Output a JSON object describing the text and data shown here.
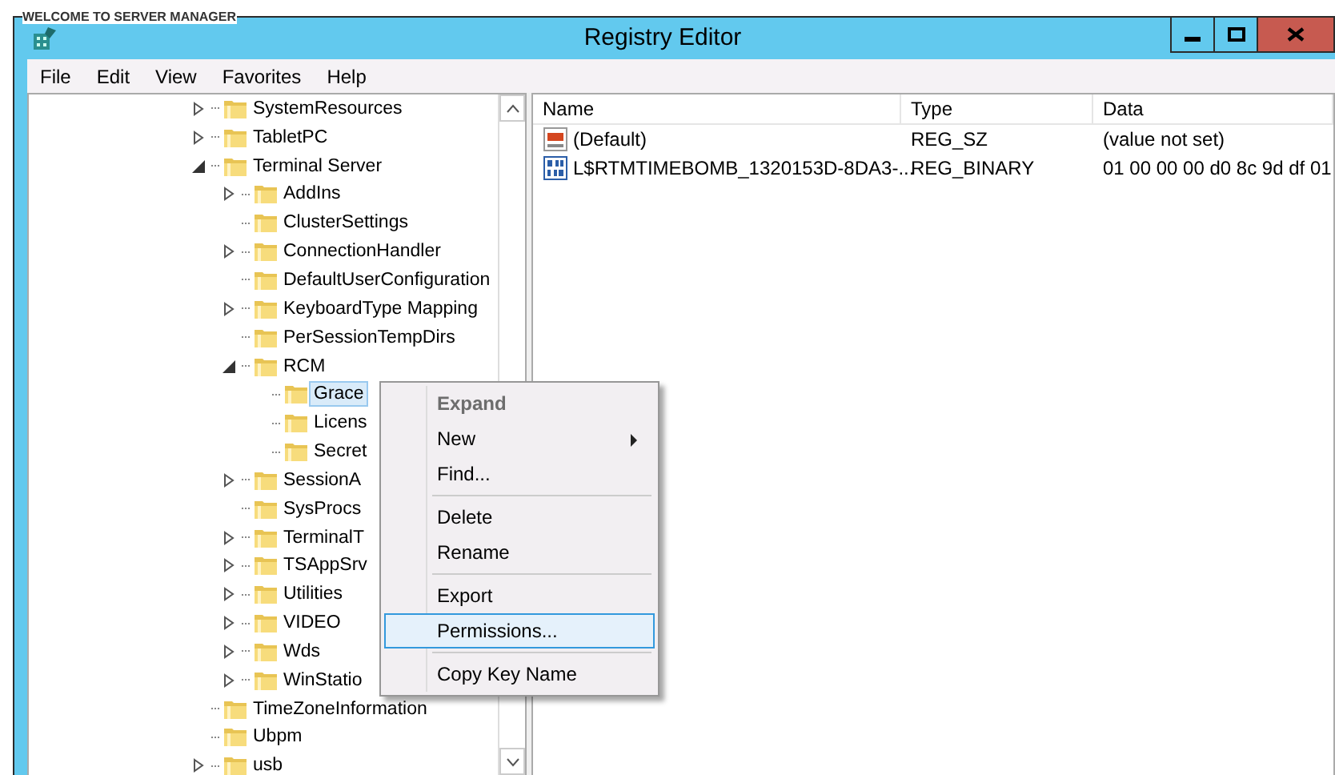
{
  "background": {
    "title": "WELCOME TO SERVER MANAGER"
  },
  "window": {
    "title": "Registry Editor"
  },
  "menu_bar": [
    "File",
    "Edit",
    "View",
    "Favorites",
    "Help"
  ],
  "tree": [
    {
      "label": "SystemResources",
      "kind": "branch",
      "expanded": false,
      "selected": false
    },
    {
      "label": "TabletPC",
      "kind": "branch",
      "expanded": false,
      "selected": false
    },
    {
      "label": "Terminal Server",
      "kind": "branch",
      "expanded": true,
      "selected": false,
      "children": [
        {
          "label": "AddIns",
          "kind": "branch",
          "expanded": false,
          "selected": false
        },
        {
          "label": "ClusterSettings",
          "kind": "leaf",
          "selected": false
        },
        {
          "label": "ConnectionHandler",
          "kind": "branch",
          "expanded": false,
          "selected": false
        },
        {
          "label": "DefaultUserConfiguration",
          "kind": "leaf",
          "selected": false
        },
        {
          "label": "KeyboardType Mapping",
          "kind": "branch",
          "expanded": false,
          "selected": false
        },
        {
          "label": "PerSessionTempDirs",
          "kind": "leaf",
          "selected": false
        },
        {
          "label": "RCM",
          "kind": "branch",
          "expanded": true,
          "selected": false,
          "children": [
            {
              "label": "Grace",
              "kind": "leaf",
              "selected": true
            },
            {
              "label": "Licens",
              "kind": "leaf",
              "selected": false
            },
            {
              "label": "Secret",
              "kind": "leaf",
              "selected": false
            }
          ]
        },
        {
          "label": "SessionA",
          "kind": "branch",
          "expanded": false,
          "selected": false
        },
        {
          "label": "SysProcs",
          "kind": "leaf",
          "selected": false
        },
        {
          "label": "TerminalT",
          "kind": "branch",
          "expanded": false,
          "selected": false
        },
        {
          "label": "TSAppSrv",
          "kind": "branch",
          "expanded": false,
          "selected": false
        },
        {
          "label": "Utilities",
          "kind": "branch",
          "expanded": false,
          "selected": false
        },
        {
          "label": "VIDEO",
          "kind": "branch",
          "expanded": false,
          "selected": false
        },
        {
          "label": "Wds",
          "kind": "branch",
          "expanded": false,
          "selected": false
        },
        {
          "label": "WinStatio",
          "kind": "branch",
          "expanded": false,
          "selected": false
        }
      ]
    },
    {
      "label": "TimeZoneInformation",
      "kind": "leaf",
      "selected": false
    },
    {
      "label": "Ubpm",
      "kind": "leaf",
      "selected": false
    },
    {
      "label": "usb",
      "kind": "branch",
      "expanded": false,
      "selected": false
    }
  ],
  "values": {
    "columns": [
      "Name",
      "Type",
      "Data"
    ],
    "rows": [
      {
        "kind": "string",
        "name": "(Default)",
        "type": "REG_SZ",
        "data": "(value not set)"
      },
      {
        "kind": "binary",
        "name": "L$RTMTIMEBOMB_1320153D-8DA3-...",
        "type": "REG_BINARY",
        "data": "01 00 00 00 d0 8c 9d df 01"
      }
    ]
  },
  "context_menu": [
    {
      "kind": "item",
      "label": "Expand",
      "default": true,
      "disabled": true,
      "submenu": false,
      "selected": false
    },
    {
      "kind": "item",
      "label": "New",
      "default": false,
      "disabled": false,
      "submenu": true,
      "selected": false
    },
    {
      "kind": "item",
      "label": "Find...",
      "default": false,
      "disabled": false,
      "submenu": false,
      "selected": false
    },
    {
      "kind": "separator"
    },
    {
      "kind": "item",
      "label": "Delete",
      "default": false,
      "disabled": false,
      "submenu": false,
      "selected": false
    },
    {
      "kind": "item",
      "label": "Rename",
      "default": false,
      "disabled": false,
      "submenu": false,
      "selected": false
    },
    {
      "kind": "separator"
    },
    {
      "kind": "item",
      "label": "Export",
      "default": false,
      "disabled": false,
      "submenu": false,
      "selected": false
    },
    {
      "kind": "item",
      "label": "Permissions...",
      "default": false,
      "disabled": false,
      "submenu": false,
      "selected": true
    },
    {
      "kind": "separator"
    },
    {
      "kind": "item",
      "label": "Copy Key Name",
      "default": false,
      "disabled": false,
      "submenu": false,
      "selected": false
    }
  ]
}
